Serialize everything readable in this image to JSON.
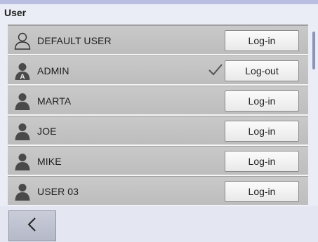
{
  "header": {
    "title": "User"
  },
  "users": [
    {
      "name": "DEFAULT USER",
      "button": "Log-in",
      "icon": "user-outline-icon",
      "active": false
    },
    {
      "name": "ADMIN",
      "button": "Log-out",
      "icon": "admin-user-icon",
      "active": true
    },
    {
      "name": "MARTA",
      "button": "Log-in",
      "icon": "user-icon",
      "active": false
    },
    {
      "name": "JOE",
      "button": "Log-in",
      "icon": "user-icon",
      "active": false
    },
    {
      "name": "MIKE",
      "button": "Log-in",
      "icon": "user-icon",
      "active": false
    },
    {
      "name": "USER 03",
      "button": "Log-in",
      "icon": "user-icon",
      "active": false
    }
  ],
  "footer": {
    "back_icon": "chevron-left-icon"
  },
  "colors": {
    "row_bg": "#c4c4c4",
    "button_bg": "#f3f3f3",
    "accent": "#b8bfe0"
  }
}
